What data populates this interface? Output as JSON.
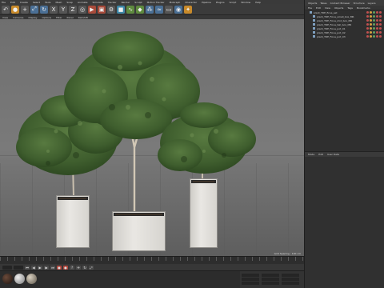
{
  "menu": [
    "File",
    "Edit",
    "Create",
    "Select",
    "Tools",
    "Mesh",
    "Snap",
    "Animate",
    "Simulate",
    "Tracker",
    "Render",
    "Sculpt",
    "Motion Tracker",
    "MoGraph",
    "Character",
    "Pipeline",
    "Plugins",
    "Script",
    "Window",
    "Help"
  ],
  "viewport": {
    "menu": [
      "View",
      "Cameras",
      "Display",
      "Options",
      "Filter",
      "Panel",
      "Redshift"
    ]
  },
  "object_manager": {
    "tabs": [
      "Objects",
      "Takes",
      "Content Browser",
      "Structure",
      "Layers"
    ],
    "menu": [
      "File",
      "Edit",
      "View",
      "Objects",
      "Tags",
      "Bookmarks"
    ],
    "objects": [
      {
        "name": "plant_TRE_ficus_set"
      },
      {
        "name": "plant_TRE_Ficus_small_box_MR"
      },
      {
        "name": "plant_TRE_Ficus_mid_box_MR"
      },
      {
        "name": "plant_TRE_Ficus_tall_box_MR"
      },
      {
        "name": "plant_TRE_Ficus_pot_01"
      },
      {
        "name": "plant_TRE_Ficus_pot_02"
      },
      {
        "name": "plant_TRE_Ficus_pot_03"
      }
    ]
  },
  "attribute_manager": {
    "menu": [
      "Mode",
      "Edit",
      "User Data"
    ]
  },
  "timeline": {
    "status": "Grid Spacing : 100 cm"
  },
  "colors": {
    "toolbar_blue": "#4a6f95",
    "record_red": "#b0443a",
    "foliage": "#3f5e2e",
    "planter": "#e2e0dc"
  }
}
